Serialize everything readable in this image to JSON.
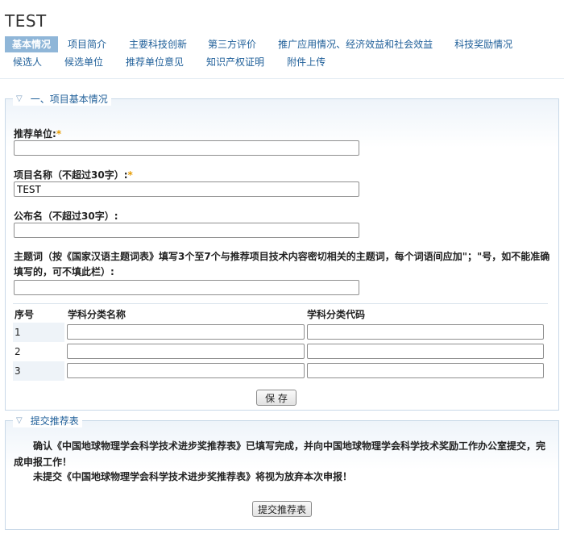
{
  "page": {
    "title": "TEST"
  },
  "tabs": {
    "row1": [
      "基本情况",
      "项目简介",
      "主要科技创新",
      "第三方评价",
      "推广应用情况、经济效益和社会效益",
      "科技奖励情况"
    ],
    "row2": [
      "候选人",
      "候选单位",
      "推荐单位意见",
      "知识产权证明",
      "附件上传"
    ],
    "active": "基本情况"
  },
  "section1": {
    "legend": "一、项目基本情况",
    "recommender": {
      "label": "推荐单位:",
      "required_mark": "*",
      "value": ""
    },
    "project_name": {
      "label": "项目名称（不超过30字）:",
      "required_mark": "*",
      "value": "TEST"
    },
    "public_name": {
      "label": "公布名（不超过30字）:",
      "value": ""
    },
    "keywords": {
      "label": "主题词（按《国家汉语主题词表》填写3个至7个与推荐项目技术内容密切相关的主题词，每个词语间应加\"；\"号，如不能准确填写的，可不填此栏）:",
      "value": ""
    },
    "subject_table": {
      "headers": [
        "序号",
        "学科分类名称",
        "学科分类代码"
      ],
      "rows": [
        {
          "no": "1",
          "name": "",
          "code": ""
        },
        {
          "no": "2",
          "name": "",
          "code": ""
        },
        {
          "no": "3",
          "name": "",
          "code": ""
        }
      ]
    },
    "save_label": "保 存"
  },
  "section2": {
    "legend": "提交推荐表",
    "para1": "确认《中国地球物理学会科学技术进步奖推荐表》已填写完成，并向中国地球物理学会科学技术奖励工作办公室提交，完成申报工作！",
    "para2": "未提交《中国地球物理学会科学技术进步奖推荐表》将视为放弃本次申报！",
    "submit_label": "提交推荐表"
  },
  "colors": {
    "accent": "#1f5f99",
    "active_tab": "#8fb6d8",
    "required": "#e69b00"
  },
  "icons": {
    "collapse": "triangle-down-icon"
  }
}
